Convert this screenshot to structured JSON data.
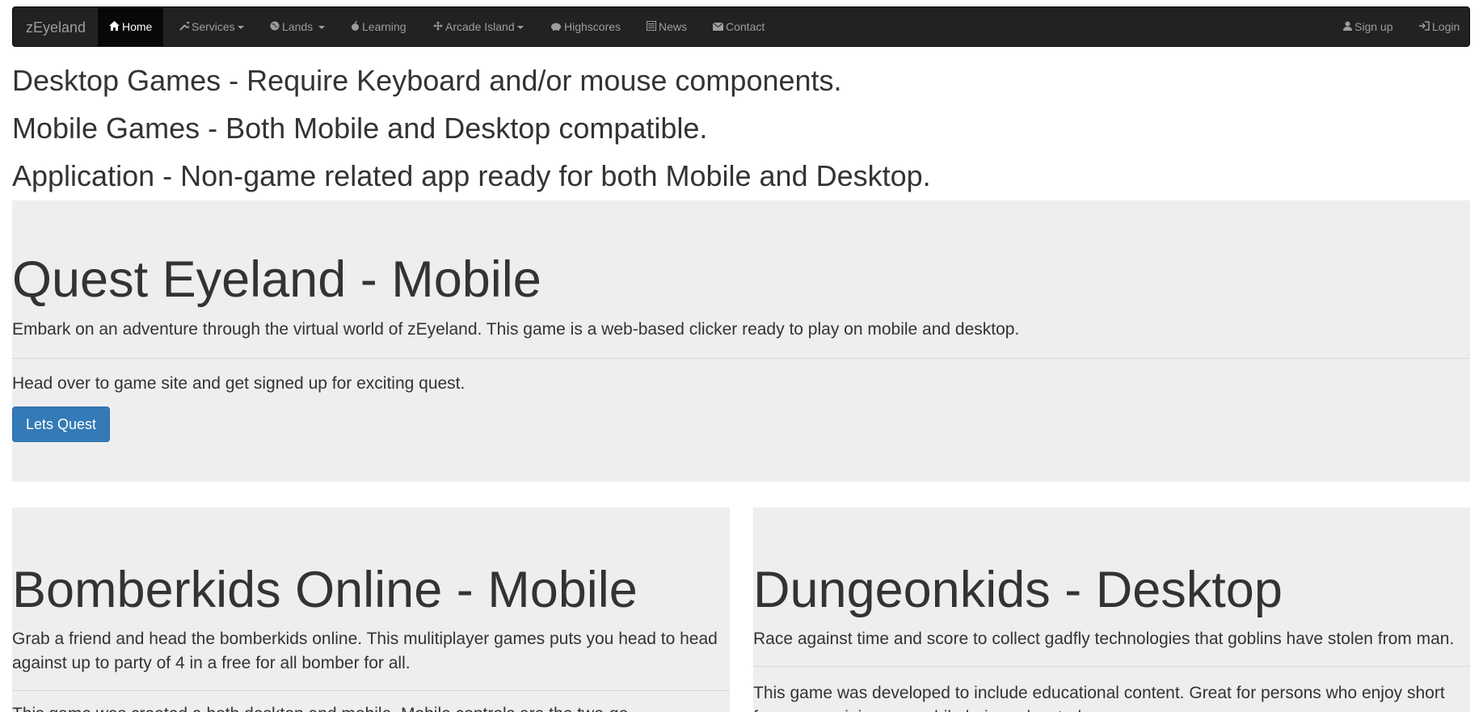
{
  "navbar": {
    "brand": "zEyeland",
    "items": [
      {
        "label": "Home",
        "icon": "home-icon"
      },
      {
        "label": "Services",
        "icon": "wrench-icon"
      },
      {
        "label": "Lands",
        "icon": "globe-icon"
      },
      {
        "label": "Learning",
        "icon": "apple-icon"
      },
      {
        "label": "Arcade Island",
        "icon": "move-icon"
      },
      {
        "label": "Highscores",
        "icon": "piggy-bank-icon"
      },
      {
        "label": "News",
        "icon": "list-alt-icon"
      },
      {
        "label": "Contact",
        "icon": "envelope-icon"
      }
    ],
    "right": [
      {
        "label": "Sign up",
        "icon": "user-icon"
      },
      {
        "label": "Login",
        "icon": "log-in-icon"
      }
    ]
  },
  "legend": [
    "Desktop Games - Require Keyboard and/or mouse components.",
    "Mobile Games - Both Mobile and Desktop compatible.",
    "Application - Non-game related app ready for both Mobile and Desktop."
  ],
  "quest": {
    "title": "Quest Eyeland - Mobile",
    "description": "Embark on an adventure through the virtual world of zEyeland. This game is a web-based clicker ready to play on mobile and desktop.",
    "cta_text": "Head over to game site and get signed up for exciting quest.",
    "button": "Lets Quest"
  },
  "bomberkids": {
    "title": "Bomberkids Online - Mobile",
    "description": "Grab a friend and head the bomberkids online. This mulitiplayer games puts you head to head against up to party of 4 in a free for all bomber for all.",
    "more": "This game was created a both desktop and mobile. Mobile controls are the two-ge..."
  },
  "dungeonkids": {
    "title": "Dungeonkids - Desktop",
    "description": "Race against time and score to collect gadfly technologies that goblins have stolen from man.",
    "more": "This game was developed to include educational content. Great for persons who enjoy short free roam mini games while being educated."
  },
  "colors": {
    "navbar_bg": "#222222",
    "navbar_text": "#9d9d9d",
    "jumbotron_bg": "#eeeeee",
    "primary": "#337ab7"
  }
}
